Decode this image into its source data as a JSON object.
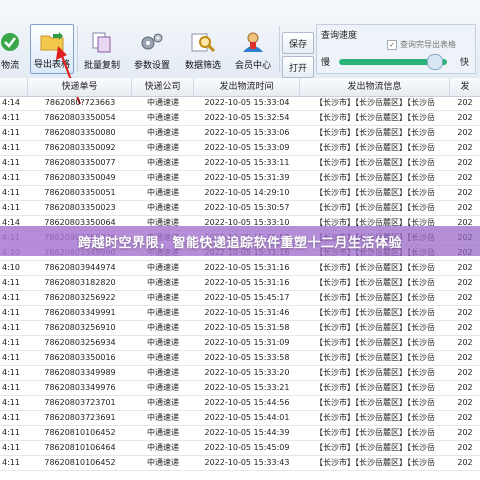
{
  "toolbar": {
    "buttons": [
      {
        "label": "物流"
      },
      {
        "label": "导出表格"
      },
      {
        "label": "批量复制"
      },
      {
        "label": "参数设置"
      },
      {
        "label": "数据筛选"
      },
      {
        "label": "会员中心"
      }
    ],
    "save_label": "保存",
    "open_label": "打开",
    "speed_title": "查询速度",
    "auto_export_label": "查询完导出表格",
    "slow_label": "慢",
    "fast_label": "快",
    "speed_level": 0.88
  },
  "table": {
    "columns": [
      "",
      "快递单号",
      "快递公司",
      "发出物流时间",
      "发出物流信息",
      "发"
    ],
    "rows": [
      {
        "c0": "4:14",
        "tracking": "7862080?723663",
        "company": "中通速递",
        "time": "2022-10-05 15:33:04",
        "info": "【长沙市】【长沙岳麓区】【长沙岳",
        "c5": "202"
      },
      {
        "c0": "4:11",
        "tracking": "78620803350054",
        "company": "中通速递",
        "time": "2022-10-05 15:32:54",
        "info": "【长沙市】【长沙岳麓区】【长沙岳",
        "c5": "202"
      },
      {
        "c0": "4:11",
        "tracking": "78620803350080",
        "company": "中通速递",
        "time": "2022-10-05 15:33:06",
        "info": "【长沙市】【长沙岳麓区】【长沙岳",
        "c5": "202"
      },
      {
        "c0": "4:11",
        "tracking": "78620803350092",
        "company": "中通速递",
        "time": "2022-10-05 15:33:09",
        "info": "【长沙市】【长沙岳麓区】【长沙岳",
        "c5": "202"
      },
      {
        "c0": "4:11",
        "tracking": "78620803350077",
        "company": "中通速递",
        "time": "2022-10-05 15:33:11",
        "info": "【长沙市】【长沙岳麓区】【长沙岳",
        "c5": "202"
      },
      {
        "c0": "4:11",
        "tracking": "78620803350049",
        "company": "中通速递",
        "time": "2022-10-05 15:31:39",
        "info": "【长沙市】【长沙岳麓区】【长沙岳",
        "c5": "202"
      },
      {
        "c0": "4:11",
        "tracking": "78620803350051",
        "company": "中通速递",
        "time": "2022-10-05 14:29:10",
        "info": "【长沙市】【长沙岳麓区】【长沙岳",
        "c5": "202"
      },
      {
        "c0": "4:11",
        "tracking": "78620803350023",
        "company": "中通速递",
        "time": "2022-10-05 15:30:57",
        "info": "【长沙市】【长沙岳麓区】【长沙岳",
        "c5": "202"
      },
      {
        "c0": "4:14",
        "tracking": "78620803350064",
        "company": "中通速递",
        "time": "2022-10-05 15:33:10",
        "info": "【长沙市】【长沙岳麓区】【长沙岳",
        "c5": "202"
      },
      {
        "c0": "4:11",
        "tracking": "78620803350036",
        "company": "中通速递",
        "time": "2022-10-05 15:30:53",
        "info": "【长沙市】【长沙岳麓区】【长沙岳",
        "c5": "202"
      },
      {
        "c0": "4:10",
        "tracking": "78620803349990",
        "company": "中通速递",
        "time": "2022-10-05 15:31:16",
        "info": "【长沙市】【长沙岳麓区】【长沙岳",
        "c5": "202"
      },
      {
        "c0": "4:10",
        "tracking": "78620803944974",
        "company": "中通速递",
        "time": "2022-10-05 15:31:16",
        "info": "【长沙市】【长沙岳麓区】【长沙岳",
        "c5": "202"
      },
      {
        "c0": "4:11",
        "tracking": "78620803182820",
        "company": "中通速递",
        "time": "2022-10-05 15:31:16",
        "info": "【长沙市】【长沙岳麓区】【长沙岳",
        "c5": "202"
      },
      {
        "c0": "4:11",
        "tracking": "78620803256922",
        "company": "中通速递",
        "time": "2022-10-05 15:45:17",
        "info": "【长沙市】【长沙岳麓区】【长沙岳",
        "c5": "202"
      },
      {
        "c0": "4:11",
        "tracking": "78620803349991",
        "company": "中通速递",
        "time": "2022-10-05 15:31:46",
        "info": "【长沙市】【长沙岳麓区】【长沙岳",
        "c5": "202"
      },
      {
        "c0": "4:11",
        "tracking": "78620803256910",
        "company": "中通速递",
        "time": "2022-10-05 15:31:58",
        "info": "【长沙市】【长沙岳麓区】【长沙岳",
        "c5": "202"
      },
      {
        "c0": "4:11",
        "tracking": "78620803256934",
        "company": "中通速递",
        "time": "2022-10-05 15:31:09",
        "info": "【长沙市】【长沙岳麓区】【长沙岳",
        "c5": "202"
      },
      {
        "c0": "4:11",
        "tracking": "78620803350016",
        "company": "中通速递",
        "time": "2022-10-05 15:33:58",
        "info": "【长沙市】【长沙岳麓区】【长沙岳",
        "c5": "202"
      },
      {
        "c0": "4:11",
        "tracking": "78620803349989",
        "company": "中通速递",
        "time": "2022-10-05 15:33:20",
        "info": "【长沙市】【长沙岳麓区】【长沙岳",
        "c5": "202"
      },
      {
        "c0": "4:11",
        "tracking": "78620803349976",
        "company": "中通速递",
        "time": "2022-10-05 15:33:21",
        "info": "【长沙市】【长沙岳麓区】【长沙岳",
        "c5": "202"
      },
      {
        "c0": "4:11",
        "tracking": "78620803723701",
        "company": "中通速递",
        "time": "2022-10-05 15:44:56",
        "info": "【长沙市】【长沙岳麓区】【长沙岳",
        "c5": "202"
      },
      {
        "c0": "4:11",
        "tracking": "78620803723691",
        "company": "中通速递",
        "time": "2022-10-05 15:44:01",
        "info": "【长沙市】【长沙岳麓区】【长沙岳",
        "c5": "202"
      },
      {
        "c0": "4:11",
        "tracking": "78620810106452",
        "company": "中通速递",
        "time": "2022-10-05 15:44:39",
        "info": "【长沙市】【长沙岳麓区】【长沙岳",
        "c5": "202"
      },
      {
        "c0": "4:11",
        "tracking": "78620810106464",
        "company": "中通速递",
        "time": "2022-10-05 15:45:09",
        "info": "【长沙市】【长沙岳麓区】【长沙岳",
        "c5": "202"
      },
      {
        "c0": "4:11",
        "tracking": "78620810106452",
        "company": "中通速递",
        "time": "2022-10-05 15:33:43",
        "info": "【长沙市】【长沙岳麓区】【长沙岳",
        "c5": "202"
      }
    ]
  },
  "banner": {
    "text": "跨越时空界限，智能快递追踪软件重塑十二月生活体验"
  }
}
